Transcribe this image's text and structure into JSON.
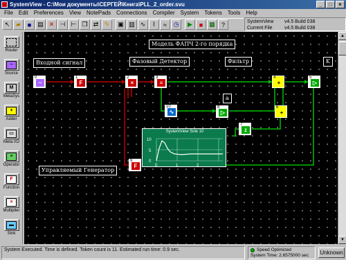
{
  "window": {
    "title": "SystemView - C:\\Мои документы\\СЕРГЕЙ\\Книга\\PLL_2_order.svu"
  },
  "menu": [
    "File",
    "Edit",
    "Preferences",
    "View",
    "NotePads",
    "Connections",
    "Compiler",
    "System",
    "Tokens",
    "Tools",
    "Help"
  ],
  "info": {
    "version_label": "SystemView",
    "version": "v4.5 Build 038",
    "file_label": "Current File",
    "file_version": "v4.5 Build 038"
  },
  "sidebar": [
    {
      "label": "Router",
      "glyph": ""
    },
    {
      "label": "Source",
      "glyph": "~"
    },
    {
      "label": "MetaSys",
      "glyph": "M"
    },
    {
      "label": "Adder",
      "glyph": "+"
    },
    {
      "label": "Meta I/O",
      "glyph": "▭"
    },
    {
      "label": "Operator",
      "glyph": "≡"
    },
    {
      "label": "Function",
      "glyph": "F"
    },
    {
      "label": "Multiplier",
      "glyph": "×"
    },
    {
      "label": "Sink",
      "glyph": "▬"
    }
  ],
  "canvas": {
    "title_label": "Модель ФАПЧ 2-го порядка",
    "labels": {
      "input": "Входной сигнал",
      "phase_detector": "Фазовый Детектор",
      "filter": "Фильтр",
      "k": "K",
      "a": "a",
      "vco": "Управляемый Генератор"
    },
    "token_numbers": [
      "0",
      "1",
      "2",
      "3",
      "4",
      "5",
      "6",
      "7",
      "8",
      "9",
      "10"
    ],
    "sink": {
      "title": "SystemView Sink 10",
      "yticks": [
        "10",
        "5",
        "0"
      ],
      "xticks": [
        "0",
        "1",
        "2"
      ],
      "colors": {
        "background": "#0b7a4d",
        "trace": "#ffffff"
      }
    }
  },
  "status": {
    "message": "System Executed. Time is defined. Token count is 11. Estimated run time: 0.9 sec.",
    "speed": "Speed Optimized",
    "system_time": "System Time: 2.6575000 sec",
    "unknown": "Unknown"
  }
}
